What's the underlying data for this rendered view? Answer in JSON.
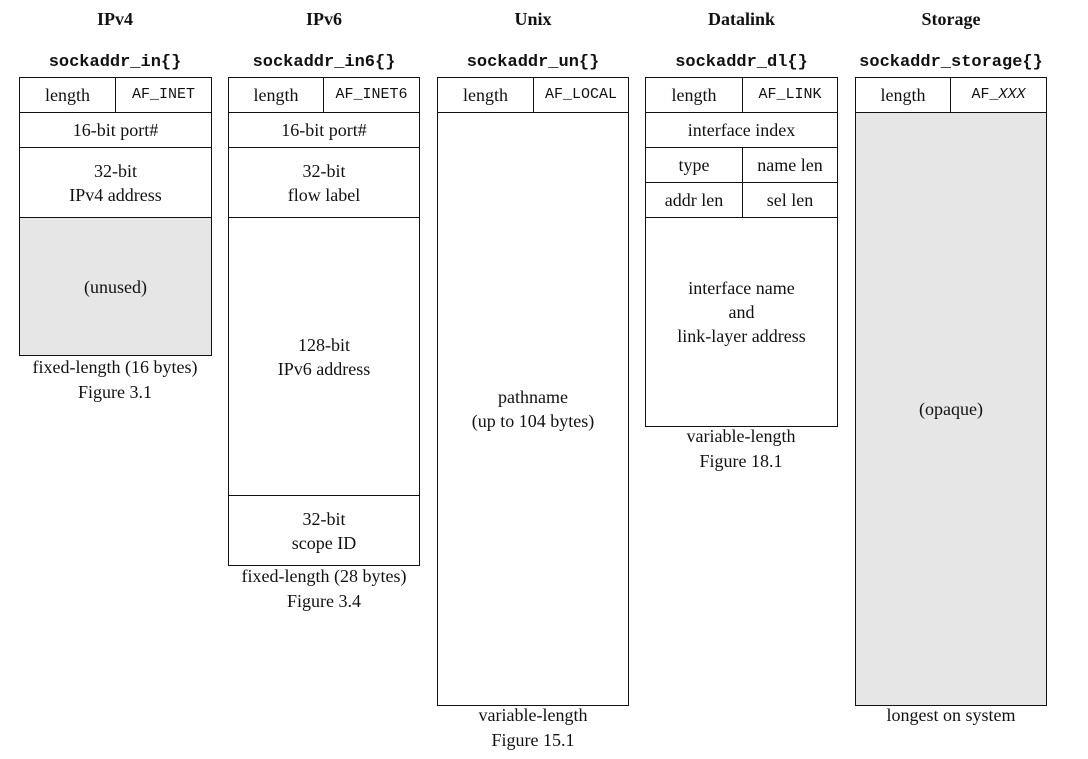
{
  "columns": [
    {
      "title": "IPv4",
      "struct": "sockaddr_in{}",
      "length": "length",
      "family": "AF_INET",
      "fields": [
        "16-bit port#",
        "32-bit",
        "IPv4 address",
        "(unused)"
      ],
      "caption": "fixed-length (16 bytes)",
      "figure": "Figure 3.1"
    },
    {
      "title": "IPv6",
      "struct": "sockaddr_in6{}",
      "length": "length",
      "family": "AF_INET6",
      "fields": [
        "16-bit port#",
        "32-bit",
        "flow label",
        "128-bit",
        "IPv6 address",
        "32-bit",
        "scope ID"
      ],
      "caption": "fixed-length (28 bytes)",
      "figure": "Figure 3.4"
    },
    {
      "title": "Unix",
      "struct": "sockaddr_un{}",
      "length": "length",
      "family": "AF_LOCAL",
      "fields": [
        "pathname",
        "(up to 104 bytes)"
      ],
      "caption": "variable-length",
      "figure": "Figure 15.1"
    },
    {
      "title": "Datalink",
      "struct": "sockaddr_dl{}",
      "length": "length",
      "family": "AF_LINK",
      "fields": [
        "interface index",
        "type",
        "name len",
        "addr len",
        "sel len",
        "interface name",
        "and",
        "link-layer address"
      ],
      "caption": "variable-length",
      "figure": "Figure 18.1"
    },
    {
      "title": "Storage",
      "struct": "sockaddr_storage{}",
      "length": "length",
      "family_prefix": "AF_",
      "family_italic": "XXX",
      "fields": [
        "(opaque)"
      ],
      "caption": "longest on system"
    }
  ],
  "colors": {
    "unused_fill": "#e6e6e6",
    "border": "#111111"
  }
}
